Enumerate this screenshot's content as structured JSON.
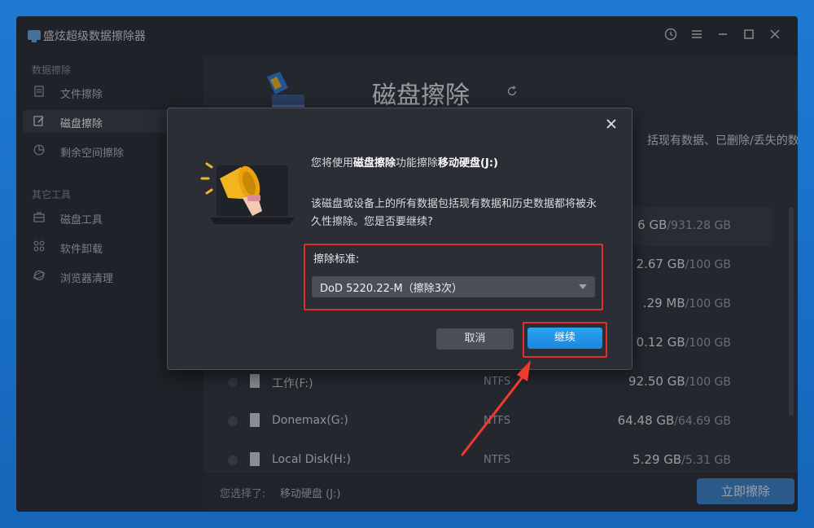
{
  "window": {
    "title": "盛炫超级数据擦除器",
    "controls": [
      "history-icon",
      "menu-icon",
      "minimize-icon",
      "maximize-icon",
      "close-icon"
    ]
  },
  "sidebar": {
    "section1": "数据擦除",
    "items1": [
      {
        "label": "文件擦除",
        "icon": "file-erase-icon"
      },
      {
        "label": "磁盘擦除",
        "icon": "disk-erase-icon",
        "active": true
      },
      {
        "label": "剩余空间擦除",
        "icon": "free-space-icon"
      }
    ],
    "section2": "其它工具",
    "items2": [
      {
        "label": "磁盘工具",
        "icon": "toolbox-icon"
      },
      {
        "label": "软件卸载",
        "icon": "apps-icon"
      },
      {
        "label": "浏览器清理",
        "icon": "browser-icon"
      }
    ]
  },
  "main": {
    "title": "磁盘擦除",
    "desc_fragment": "括现有数据、已删除/丢失的数",
    "disks": [
      {
        "name": "",
        "fs": "",
        "used": "6 GB",
        "total": "/931.28 GB",
        "highlight": true
      },
      {
        "name": "",
        "fs": "",
        "used": "2.67 GB",
        "total": "/100 GB"
      },
      {
        "name": "",
        "fs": "",
        "used": ".29 MB",
        "total": "/100 GB"
      },
      {
        "name": "",
        "fs": "",
        "used": "0.12 GB",
        "total": "/100 GB"
      },
      {
        "name": "工作(F:)",
        "fs": "NTFS",
        "used": "92.50 GB",
        "total": "/100 GB"
      },
      {
        "name": "Donemax(G:)",
        "fs": "NTFS",
        "used": "64.48 GB",
        "total": "/64.69 GB"
      },
      {
        "name": "Local Disk(H:)",
        "fs": "NTFS",
        "used": "5.29 GB",
        "total": "/5.31 GB"
      }
    ],
    "footer_label": "您选择了:",
    "footer_value": "移动硬盘 (J:)",
    "erase_button": "立即擦除"
  },
  "dialog": {
    "line1_a": "您将使用",
    "line1_b": "磁盘擦除",
    "line1_c": "功能擦除",
    "line1_d": "移动硬盘(J:)",
    "warning": "该磁盘或设备上的所有数据包括现有数据和历史数据都将被永久性擦除。您是否要继续?",
    "standard_label": "擦除标准:",
    "standard_value": "DoD 5220.22-M（擦除3次）",
    "cancel": "取消",
    "continue": "继续"
  },
  "colors": {
    "accent": "#1b86dd",
    "highlight_box": "#e0322a",
    "arrow": "#ef3b2c"
  }
}
